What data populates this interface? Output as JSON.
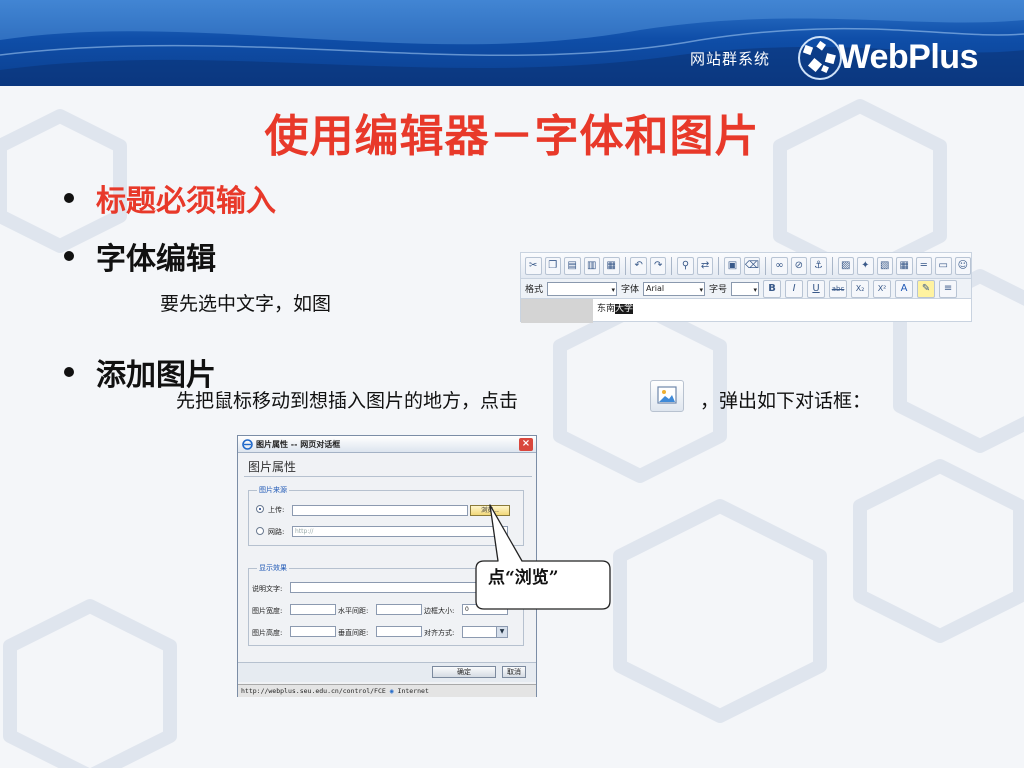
{
  "banner": {
    "system_label": "网站群系统",
    "logo_text": "WebPlus"
  },
  "slide": {
    "title": "使用编辑器－字体和图片",
    "bullets": [
      {
        "text": "标题必须输入",
        "color": "#e8392a"
      },
      {
        "text": "字体编辑",
        "note": "要先选中文字，如图"
      },
      {
        "text": "添加图片",
        "note_before": "先把鼠标移动到想插入图片的地方，点击",
        "note_after": "，弹出如下对话框："
      }
    ]
  },
  "toolbar_shot": {
    "format_label": "格式",
    "font_label": "字体",
    "font_value": "Arial",
    "size_label": "字号",
    "bold": "B",
    "italic": "I",
    "underline": "U",
    "strike": "abc",
    "sub": "X₂",
    "sup": "X²",
    "sample_text": "东南",
    "sample_selected": "大学"
  },
  "dialog": {
    "window_title": "图片属性 -- 网页对话框",
    "heading": "图片属性",
    "source_legend": "图片来源",
    "upload_label": "上传:",
    "browse_label": "浏览...",
    "network_label": "网路:",
    "network_placeholder": "http://",
    "display_legend": "显示效果",
    "alt_label": "说明文字:",
    "width_label": "图片宽度:",
    "hspace_label": "水平间距:",
    "border_label": "边框大小:",
    "border_value": "0",
    "height_label": "图片高度:",
    "vspace_label": "垂直间距:",
    "align_label": "对齐方式:",
    "ok_label": "确定",
    "cancel_label": "取消",
    "status_url": "http://webplus.seu.edu.cn/control/FCE",
    "status_zone": "Internet"
  },
  "callout": {
    "text": "点“浏览”"
  },
  "colors": {
    "title_red": "#e8392a",
    "banner_blue": "#0f4ea8"
  }
}
